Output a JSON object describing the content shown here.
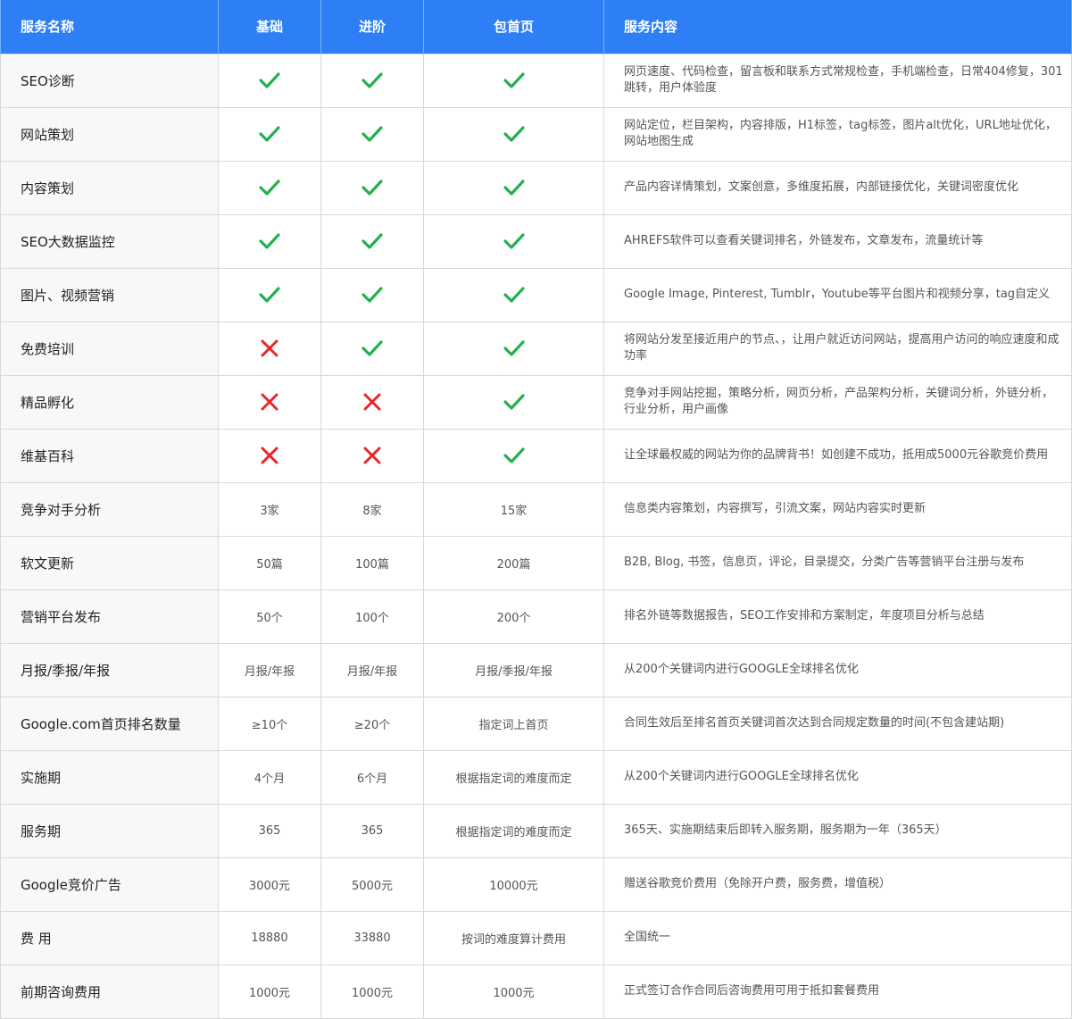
{
  "header": {
    "col_name": "服务名称",
    "col_basic": "基础",
    "col_advanced": "进阶",
    "col_homepage": "包首页",
    "col_content": "服务内容"
  },
  "colors": {
    "header_bg": "#2e7ff5",
    "check": "#22b14c",
    "cross": "#e8262a"
  },
  "rows": [
    {
      "name": "SEO诊断",
      "basic": "check",
      "advanced": "check",
      "homepage": "check",
      "desc": "网页速度、代码检查，留言板和联系方式常规检查，手机端检查，日常404修复，301跳转，用户体验度"
    },
    {
      "name": "网站策划",
      "basic": "check",
      "advanced": "check",
      "homepage": "check",
      "desc": "网站定位，栏目架构，内容排版，H1标签，tag标签，图片alt优化，URL地址优化，网站地图生成"
    },
    {
      "name": "内容策划",
      "basic": "check",
      "advanced": "check",
      "homepage": "check",
      "desc": "产品内容详情策划，文案创意，多维度拓展，内部链接优化，关键词密度优化"
    },
    {
      "name": "SEO大数据监控",
      "basic": "check",
      "advanced": "check",
      "homepage": "check",
      "desc": "AHREFS软件可以查看关键词排名，外链发布，文章发布，流量统计等"
    },
    {
      "name": "图片、视频营销",
      "basic": "check",
      "advanced": "check",
      "homepage": "check",
      "desc": "Google Image, Pinterest, Tumblr，Youtube等平台图片和视频分享，tag自定义"
    },
    {
      "name": "免费培训",
      "basic": "cross",
      "advanced": "check",
      "homepage": "check",
      "desc": "将网站分发至接近用户的节点、，让用户就近访问网站，提高用户访问的响应速度和成功率"
    },
    {
      "name": "精品孵化",
      "basic": "cross",
      "advanced": "cross",
      "homepage": "check",
      "desc": "竞争对手网站挖掘，策略分析，网页分析，产品架构分析，关键词分析，外链分析，行业分析，用户画像"
    },
    {
      "name": "维基百科",
      "basic": "cross",
      "advanced": "cross",
      "homepage": "check",
      "desc": "让全球最权威的网站为你的品牌背书！如创建不成功，抵用成5000元谷歌竞价费用"
    },
    {
      "name": "竞争对手分析",
      "basic": "3家",
      "advanced": "8家",
      "homepage": "15家",
      "desc": "信息类内容策划，内容撰写，引流文案，网站内容实时更新"
    },
    {
      "name": "软文更新",
      "basic": "50篇",
      "advanced": "100篇",
      "homepage": "200篇",
      "desc": "B2B, Blog, 书签，信息页，评论，目录提交，分类广告等营销平台注册与发布"
    },
    {
      "name": "营销平台发布",
      "basic": "50个",
      "advanced": "100个",
      "homepage": "200个",
      "desc": "排名外链等数据报告，SEO工作安排和方案制定，年度项目分析与总结"
    },
    {
      "name": "月报/季报/年报",
      "basic": "月报/年报",
      "advanced": "月报/年报",
      "homepage": "月报/季报/年报",
      "desc": "从200个关键词内进行GOOGLE全球排名优化"
    },
    {
      "name": "Google.com首页排名数量",
      "basic": "≥10个",
      "advanced": "≥20个",
      "homepage": "指定词上首页",
      "desc": "合同生效后至排名首页关键词首次达到合同规定数量的时间(不包含建站期)"
    },
    {
      "name": "实施期",
      "basic": "4个月",
      "advanced": "6个月",
      "homepage": "根据指定词的难度而定",
      "desc": "从200个关键词内进行GOOGLE全球排名优化"
    },
    {
      "name": "服务期",
      "basic": "365",
      "advanced": "365",
      "homepage": "根据指定词的难度而定",
      "desc": "365天、实施期结束后即转入服务期，服务期为一年（365天）"
    },
    {
      "name": "Google竞价广告",
      "basic": "3000元",
      "advanced": "5000元",
      "homepage": "10000元",
      "desc": "赠送谷歌竞价费用（免除开户费，服务费，增值税）"
    },
    {
      "name": "费 用",
      "basic": "18880",
      "advanced": "33880",
      "homepage": "按词的难度算计费用",
      "desc": "全国统一"
    },
    {
      "name": "前期咨询费用",
      "basic": "1000元",
      "advanced": "1000元",
      "homepage": "1000元",
      "desc": "正式签订合作合同后咨询费用可用于抵扣套餐费用"
    }
  ]
}
